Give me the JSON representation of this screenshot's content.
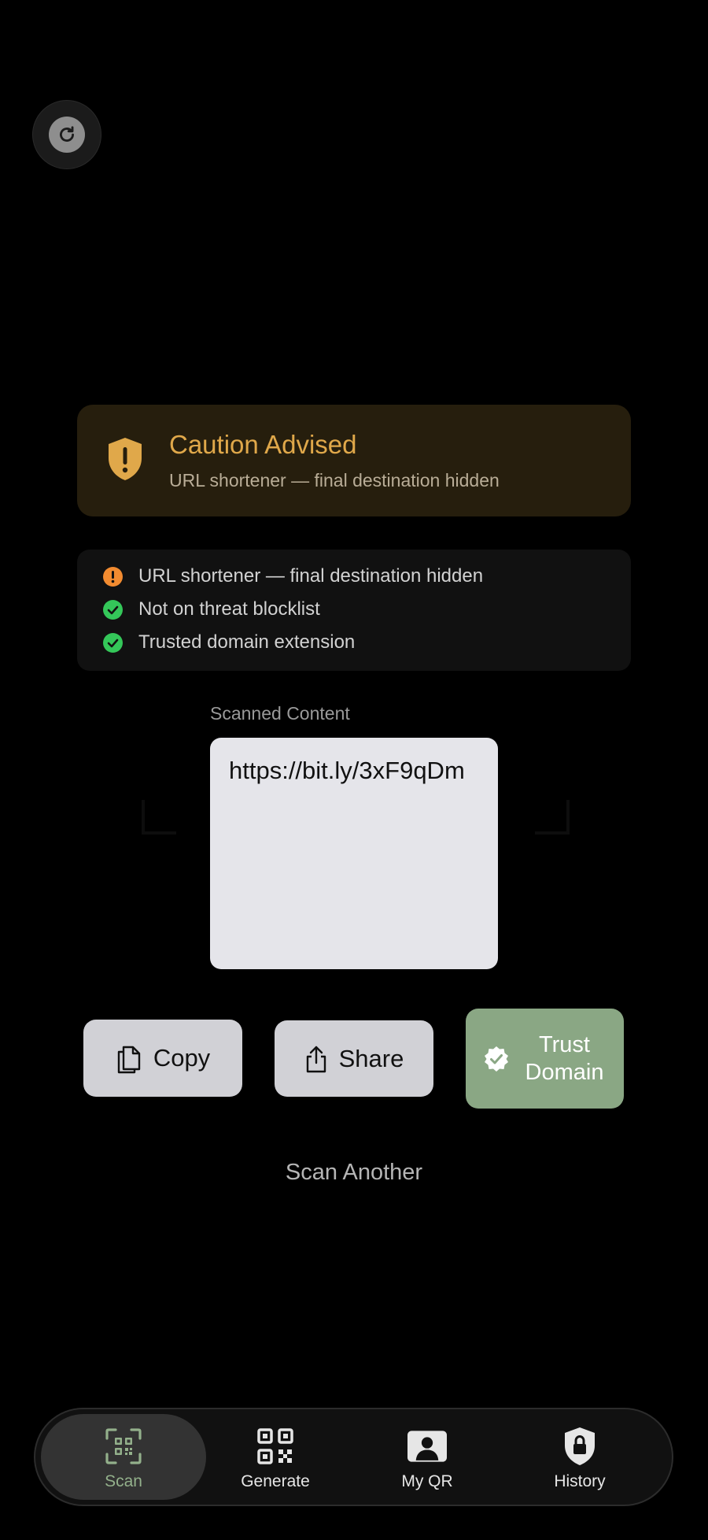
{
  "top": {
    "rotate_icon": "rotate-camera-icon"
  },
  "caution": {
    "title": "Caution Advised",
    "subtitle": "URL shortener — final destination hidden",
    "icon": "shield-exclamation-icon",
    "color": "#e0a84a",
    "background": "#261e0d"
  },
  "checks": [
    {
      "label": "URL shortener — final destination hidden",
      "status": "warning",
      "color": "#f28b30"
    },
    {
      "label": "Not on threat blocklist",
      "status": "pass",
      "color": "#34c759"
    },
    {
      "label": "Trusted domain extension",
      "status": "pass",
      "color": "#34c759"
    }
  ],
  "scanned": {
    "label": "Scanned Content",
    "value": "https://bit.ly/3xF9qDm"
  },
  "actions": {
    "copy_label": "Copy",
    "share_label": "Share",
    "trust_label": "Trust Domain",
    "trust_color": "#8aa784"
  },
  "scan_another_label": "Scan Another",
  "tabs": [
    {
      "label": "Scan",
      "icon": "qr-scan-icon",
      "active": true
    },
    {
      "label": "Generate",
      "icon": "qr-code-icon",
      "active": false
    },
    {
      "label": "My QR",
      "icon": "person-card-icon",
      "active": false
    },
    {
      "label": "History",
      "icon": "lock-shield-icon",
      "active": false
    }
  ],
  "accent_color": "#93b08b"
}
